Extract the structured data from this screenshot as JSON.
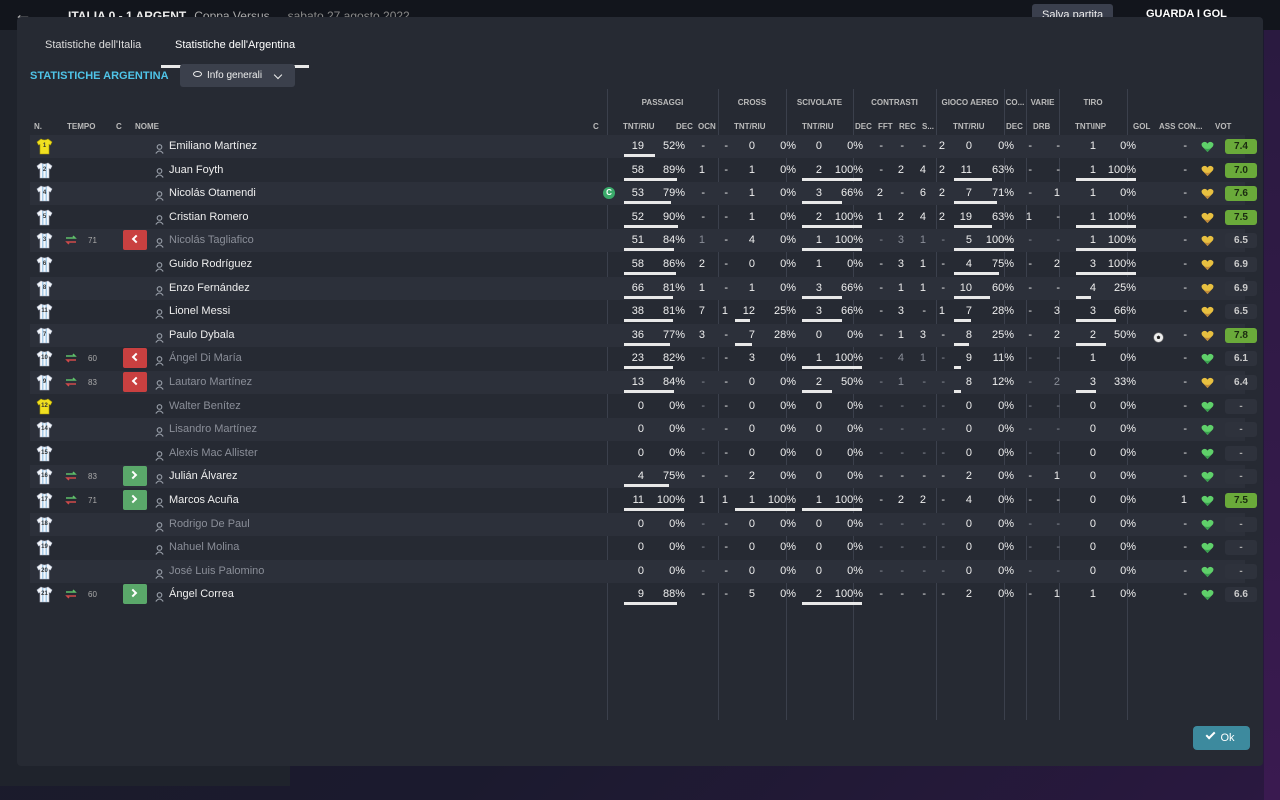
{
  "background": {
    "title": "ITALIA  0 - 1  ARGENT",
    "competition": "Coppa Versus",
    "date": "sabato 27 agosto 2022",
    "save_label": "Salva partita",
    "watch_label": "GUARDA I GOL"
  },
  "tabs": [
    "Statistiche dell'Italia",
    "Statistiche dell'Argentina"
  ],
  "section_title": "STATISTICHE ARGENTINA",
  "dropdown": {
    "label": "Info generali"
  },
  "groups": {
    "passaggi": "PASSAGGI",
    "cross": "CROSS",
    "scivolate": "SCIVOLATE",
    "contrasti": "CONTRASTI",
    "gioco_aereo": "GIOCO AEREO",
    "co": "CO...",
    "varie": "VARIE",
    "tiro": "TIRO"
  },
  "columns": {
    "n": "N.",
    "tempo": "TEMPO",
    "c": "C",
    "nome": "NOME",
    "c2": "C",
    "tntriu": "TNT/RIU",
    "dec": "DEC",
    "ocn": "OCN",
    "cross_tntriu": "TNT/RIU",
    "sciv_tntriu": "TNT/RIU",
    "cdec": "DEC",
    "fft": "FFT",
    "rec": "REC",
    "s": "S...",
    "ga_tntriu": "TNT/RIU",
    "co_dec": "DEC",
    "drb": "DRB",
    "tntinp": "TNT\\INP",
    "gol": "GOL",
    "ass": "ASS",
    "con": "CON...",
    "vot": "VOT"
  },
  "colors": {
    "accent": "#4fc4e8",
    "sub_out": "#c94040",
    "sub_in": "#5aa86a",
    "ok": "#3d8a9e"
  },
  "ok_label": "Ok",
  "players": [
    {
      "n": "1",
      "gk": true,
      "tempo": "",
      "sub": "",
      "name": "Emiliano Martínez",
      "dim": false,
      "cap": false,
      "pass": "19",
      "passp": "52%",
      "dec": "-",
      "ocn": "-",
      "cr": "0",
      "crp": "0%",
      "sv": "0",
      "svp": "0%",
      "cd": "-",
      "fft": "-",
      "rec": "-",
      "s": "2",
      "ga": "0",
      "gap": "0%",
      "codec": "-",
      "drb": "-",
      "tiro": "1",
      "tirop": "0%",
      "gol": "",
      "ass": "-",
      "heart": "green",
      "vot": "7.4",
      "votc": "hi",
      "ball": false,
      "bars": {
        "pass": 52,
        "cr": 0,
        "sv": 0,
        "ga": 0,
        "ti": 0
      }
    },
    {
      "n": "2",
      "gk": false,
      "tempo": "",
      "sub": "",
      "name": "Juan Foyth",
      "dim": false,
      "cap": false,
      "pass": "58",
      "passp": "89%",
      "dec": "1",
      "ocn": "-",
      "cr": "1",
      "crp": "0%",
      "sv": "2",
      "svp": "100%",
      "cd": "-",
      "fft": "2",
      "rec": "4",
      "s": "2",
      "ga": "11",
      "gap": "63%",
      "codec": "-",
      "drb": "-",
      "tiro": "1",
      "tirop": "100%",
      "gol": "",
      "ass": "-",
      "heart": "yellow",
      "vot": "7.0",
      "votc": "hi",
      "ball": false,
      "bars": {
        "pass": 89,
        "cr": 0,
        "sv": 100,
        "ga": 63,
        "ti": 100
      }
    },
    {
      "n": "4",
      "gk": false,
      "tempo": "",
      "sub": "",
      "name": "Nicolás Otamendi",
      "dim": false,
      "cap": true,
      "pass": "53",
      "passp": "79%",
      "dec": "-",
      "ocn": "-",
      "cr": "1",
      "crp": "0%",
      "sv": "3",
      "svp": "66%",
      "cd": "2",
      "fft": "-",
      "rec": "6",
      "s": "2",
      "ga": "7",
      "gap": "71%",
      "codec": "-",
      "drb": "1",
      "tiro": "1",
      "tirop": "0%",
      "gol": "",
      "ass": "-",
      "heart": "yellow",
      "vot": "7.6",
      "votc": "hi",
      "ball": false,
      "bars": {
        "pass": 79,
        "cr": 0,
        "sv": 66,
        "ga": 71,
        "ti": 0
      }
    },
    {
      "n": "5",
      "gk": false,
      "tempo": "",
      "sub": "",
      "name": "Cristian Romero",
      "dim": false,
      "cap": false,
      "pass": "52",
      "passp": "90%",
      "dec": "-",
      "ocn": "-",
      "cr": "1",
      "crp": "0%",
      "sv": "2",
      "svp": "100%",
      "cd": "1",
      "fft": "2",
      "rec": "4",
      "s": "2",
      "ga": "19",
      "gap": "63%",
      "codec": "1",
      "drb": "-",
      "tiro": "1",
      "tirop": "100%",
      "gol": "",
      "ass": "-",
      "heart": "yellow",
      "vot": "7.5",
      "votc": "hi",
      "ball": false,
      "bars": {
        "pass": 90,
        "cr": 0,
        "sv": 100,
        "ga": 63,
        "ti": 100
      }
    },
    {
      "n": "3",
      "gk": false,
      "tempo": "71",
      "sub": "out",
      "name": "Nicolás Tagliafico",
      "dim": true,
      "cap": false,
      "pass": "51",
      "passp": "84%",
      "dec": "1",
      "ocn": "-",
      "cr": "4",
      "crp": "0%",
      "sv": "1",
      "svp": "100%",
      "cd": "-",
      "fft": "3",
      "rec": "1",
      "s": "-",
      "ga": "5",
      "gap": "100%",
      "codec": "-",
      "drb": "-",
      "tiro": "1",
      "tirop": "100%",
      "gol": "",
      "ass": "-",
      "heart": "yellow",
      "vot": "6.5",
      "votc": "plain",
      "ball": false,
      "bars": {
        "pass": 84,
        "cr": 0,
        "sv": 100,
        "ga": 100,
        "ti": 100
      }
    },
    {
      "n": "6",
      "gk": false,
      "tempo": "",
      "sub": "",
      "name": "Guido Rodríguez",
      "dim": false,
      "cap": false,
      "pass": "58",
      "passp": "86%",
      "dec": "2",
      "ocn": "-",
      "cr": "0",
      "crp": "0%",
      "sv": "1",
      "svp": "0%",
      "cd": "-",
      "fft": "3",
      "rec": "1",
      "s": "-",
      "ga": "4",
      "gap": "75%",
      "codec": "-",
      "drb": "2",
      "tiro": "3",
      "tirop": "100%",
      "gol": "",
      "ass": "-",
      "heart": "yellow",
      "vot": "6.9",
      "votc": "plain",
      "ball": false,
      "bars": {
        "pass": 86,
        "cr": 0,
        "sv": 0,
        "ga": 75,
        "ti": 100
      }
    },
    {
      "n": "8",
      "gk": false,
      "tempo": "",
      "sub": "",
      "name": "Enzo Fernández",
      "dim": false,
      "cap": false,
      "pass": "66",
      "passp": "81%",
      "dec": "1",
      "ocn": "-",
      "cr": "1",
      "crp": "0%",
      "sv": "3",
      "svp": "66%",
      "cd": "-",
      "fft": "1",
      "rec": "1",
      "s": "-",
      "ga": "10",
      "gap": "60%",
      "codec": "-",
      "drb": "-",
      "tiro": "4",
      "tirop": "25%",
      "gol": "",
      "ass": "-",
      "heart": "yellow",
      "vot": "6.9",
      "votc": "plain",
      "ball": false,
      "bars": {
        "pass": 81,
        "cr": 0,
        "sv": 66,
        "ga": 60,
        "ti": 25
      }
    },
    {
      "n": "11",
      "gk": false,
      "tempo": "",
      "sub": "",
      "name": "Lionel Messi",
      "dim": false,
      "cap": false,
      "pass": "38",
      "passp": "81%",
      "dec": "7",
      "ocn": "1",
      "cr": "12",
      "crp": "25%",
      "sv": "3",
      "svp": "66%",
      "cd": "-",
      "fft": "3",
      "rec": "-",
      "s": "1",
      "ga": "7",
      "gap": "28%",
      "codec": "-",
      "drb": "3",
      "tiro": "3",
      "tirop": "66%",
      "gol": "",
      "ass": "-",
      "heart": "yellow",
      "vot": "6.5",
      "votc": "plain",
      "ball": false,
      "bars": {
        "pass": 81,
        "cr": 25,
        "sv": 66,
        "ga": 28,
        "ti": 66
      }
    },
    {
      "n": "7",
      "gk": false,
      "tempo": "",
      "sub": "",
      "name": "Paulo Dybala",
      "dim": false,
      "cap": false,
      "pass": "36",
      "passp": "77%",
      "dec": "3",
      "ocn": "-",
      "cr": "7",
      "crp": "28%",
      "sv": "0",
      "svp": "0%",
      "cd": "-",
      "fft": "1",
      "rec": "3",
      "s": "-",
      "ga": "8",
      "gap": "25%",
      "codec": "-",
      "drb": "2",
      "tiro": "2",
      "tirop": "50%",
      "gol": "",
      "ass": "-",
      "heart": "yellow",
      "vot": "7.8",
      "votc": "hi",
      "ball": true,
      "bars": {
        "pass": 77,
        "cr": 28,
        "sv": 0,
        "ga": 25,
        "ti": 50
      }
    },
    {
      "n": "10",
      "gk": false,
      "tempo": "60",
      "sub": "out",
      "name": "Ángel Di María",
      "dim": true,
      "cap": false,
      "pass": "23",
      "passp": "82%",
      "dec": "-",
      "ocn": "-",
      "cr": "3",
      "crp": "0%",
      "sv": "1",
      "svp": "100%",
      "cd": "-",
      "fft": "4",
      "rec": "1",
      "s": "-",
      "ga": "9",
      "gap": "11%",
      "codec": "-",
      "drb": "-",
      "tiro": "1",
      "tirop": "0%",
      "gol": "",
      "ass": "-",
      "heart": "green",
      "vot": "6.1",
      "votc": "plain",
      "ball": false,
      "bars": {
        "pass": 82,
        "cr": 0,
        "sv": 100,
        "ga": 11,
        "ti": 0
      }
    },
    {
      "n": "9",
      "gk": false,
      "tempo": "83",
      "sub": "out",
      "name": "Lautaro Martínez",
      "dim": true,
      "cap": false,
      "pass": "13",
      "passp": "84%",
      "dec": "-",
      "ocn": "-",
      "cr": "0",
      "crp": "0%",
      "sv": "2",
      "svp": "50%",
      "cd": "-",
      "fft": "1",
      "rec": "-",
      "s": "-",
      "ga": "8",
      "gap": "12%",
      "codec": "-",
      "drb": "2",
      "tiro": "3",
      "tirop": "33%",
      "gol": "",
      "ass": "-",
      "heart": "yellow",
      "vot": "6.4",
      "votc": "plain",
      "ball": false,
      "bars": {
        "pass": 84,
        "cr": 0,
        "sv": 50,
        "ga": 12,
        "ti": 33
      }
    },
    {
      "n": "12",
      "gk": true,
      "tempo": "",
      "sub": "",
      "name": "Walter Benítez",
      "dim": true,
      "cap": false,
      "pass": "0",
      "passp": "0%",
      "dec": "-",
      "ocn": "-",
      "cr": "0",
      "crp": "0%",
      "sv": "0",
      "svp": "0%",
      "cd": "-",
      "fft": "-",
      "rec": "-",
      "s": "-",
      "ga": "0",
      "gap": "0%",
      "codec": "-",
      "drb": "-",
      "tiro": "0",
      "tirop": "0%",
      "gol": "",
      "ass": "-",
      "heart": "green",
      "vot": "-",
      "votc": "dash",
      "ball": false,
      "bars": {
        "pass": 0,
        "cr": 0,
        "sv": 0,
        "ga": 0,
        "ti": 0
      }
    },
    {
      "n": "14",
      "gk": false,
      "tempo": "",
      "sub": "",
      "name": "Lisandro Martínez",
      "dim": true,
      "cap": false,
      "pass": "0",
      "passp": "0%",
      "dec": "-",
      "ocn": "-",
      "cr": "0",
      "crp": "0%",
      "sv": "0",
      "svp": "0%",
      "cd": "-",
      "fft": "-",
      "rec": "-",
      "s": "-",
      "ga": "0",
      "gap": "0%",
      "codec": "-",
      "drb": "-",
      "tiro": "0",
      "tirop": "0%",
      "gol": "",
      "ass": "-",
      "heart": "green",
      "vot": "-",
      "votc": "dash",
      "ball": false,
      "bars": {
        "pass": 0,
        "cr": 0,
        "sv": 0,
        "ga": 0,
        "ti": 0
      }
    },
    {
      "n": "15",
      "gk": false,
      "tempo": "",
      "sub": "",
      "name": "Alexis Mac Allister",
      "dim": true,
      "cap": false,
      "pass": "0",
      "passp": "0%",
      "dec": "-",
      "ocn": "-",
      "cr": "0",
      "crp": "0%",
      "sv": "0",
      "svp": "0%",
      "cd": "-",
      "fft": "-",
      "rec": "-",
      "s": "-",
      "ga": "0",
      "gap": "0%",
      "codec": "-",
      "drb": "-",
      "tiro": "0",
      "tirop": "0%",
      "gol": "",
      "ass": "-",
      "heart": "green",
      "vot": "-",
      "votc": "dash",
      "ball": false,
      "bars": {
        "pass": 0,
        "cr": 0,
        "sv": 0,
        "ga": 0,
        "ti": 0
      }
    },
    {
      "n": "16",
      "gk": false,
      "tempo": "83",
      "sub": "in",
      "name": "Julián Álvarez",
      "dim": false,
      "cap": false,
      "pass": "4",
      "passp": "75%",
      "dec": "-",
      "ocn": "-",
      "cr": "2",
      "crp": "0%",
      "sv": "0",
      "svp": "0%",
      "cd": "-",
      "fft": "-",
      "rec": "-",
      "s": "-",
      "ga": "2",
      "gap": "0%",
      "codec": "-",
      "drb": "1",
      "tiro": "0",
      "tirop": "0%",
      "gol": "",
      "ass": "-",
      "heart": "green",
      "vot": "-",
      "votc": "dash",
      "ball": false,
      "bars": {
        "pass": 75,
        "cr": 0,
        "sv": 0,
        "ga": 0,
        "ti": 0
      }
    },
    {
      "n": "17",
      "gk": false,
      "tempo": "71",
      "sub": "in",
      "name": "Marcos Acuña",
      "dim": false,
      "cap": false,
      "pass": "11",
      "passp": "100%",
      "dec": "1",
      "ocn": "1",
      "cr": "1",
      "crp": "100%",
      "sv": "1",
      "svp": "100%",
      "cd": "-",
      "fft": "2",
      "rec": "2",
      "s": "-",
      "ga": "4",
      "gap": "0%",
      "codec": "-",
      "drb": "-",
      "tiro": "0",
      "tirop": "0%",
      "gol": "",
      "ass": "1",
      "heart": "green",
      "vot": "7.5",
      "votc": "hi",
      "ball": false,
      "bars": {
        "pass": 100,
        "cr": 100,
        "sv": 100,
        "ga": 0,
        "ti": 0
      }
    },
    {
      "n": "18",
      "gk": false,
      "tempo": "",
      "sub": "",
      "name": "Rodrigo De Paul",
      "dim": true,
      "cap": false,
      "pass": "0",
      "passp": "0%",
      "dec": "-",
      "ocn": "-",
      "cr": "0",
      "crp": "0%",
      "sv": "0",
      "svp": "0%",
      "cd": "-",
      "fft": "-",
      "rec": "-",
      "s": "-",
      "ga": "0",
      "gap": "0%",
      "codec": "-",
      "drb": "-",
      "tiro": "0",
      "tirop": "0%",
      "gol": "",
      "ass": "-",
      "heart": "green",
      "vot": "-",
      "votc": "dash",
      "ball": false,
      "bars": {
        "pass": 0,
        "cr": 0,
        "sv": 0,
        "ga": 0,
        "ti": 0
      }
    },
    {
      "n": "19",
      "gk": false,
      "tempo": "",
      "sub": "",
      "name": "Nahuel Molina",
      "dim": true,
      "cap": false,
      "pass": "0",
      "passp": "0%",
      "dec": "-",
      "ocn": "-",
      "cr": "0",
      "crp": "0%",
      "sv": "0",
      "svp": "0%",
      "cd": "-",
      "fft": "-",
      "rec": "-",
      "s": "-",
      "ga": "0",
      "gap": "0%",
      "codec": "-",
      "drb": "-",
      "tiro": "0",
      "tirop": "0%",
      "gol": "",
      "ass": "-",
      "heart": "green",
      "vot": "-",
      "votc": "dash",
      "ball": false,
      "bars": {
        "pass": 0,
        "cr": 0,
        "sv": 0,
        "ga": 0,
        "ti": 0
      }
    },
    {
      "n": "20",
      "gk": false,
      "tempo": "",
      "sub": "",
      "name": "José Luis Palomino",
      "dim": true,
      "cap": false,
      "pass": "0",
      "passp": "0%",
      "dec": "-",
      "ocn": "-",
      "cr": "0",
      "crp": "0%",
      "sv": "0",
      "svp": "0%",
      "cd": "-",
      "fft": "-",
      "rec": "-",
      "s": "-",
      "ga": "0",
      "gap": "0%",
      "codec": "-",
      "drb": "-",
      "tiro": "0",
      "tirop": "0%",
      "gol": "",
      "ass": "-",
      "heart": "green",
      "vot": "-",
      "votc": "dash",
      "ball": false,
      "bars": {
        "pass": 0,
        "cr": 0,
        "sv": 0,
        "ga": 0,
        "ti": 0
      }
    },
    {
      "n": "21",
      "gk": false,
      "tempo": "60",
      "sub": "in",
      "name": "Ángel Correa",
      "dim": false,
      "cap": false,
      "pass": "9",
      "passp": "88%",
      "dec": "-",
      "ocn": "-",
      "cr": "5",
      "crp": "0%",
      "sv": "2",
      "svp": "100%",
      "cd": "-",
      "fft": "-",
      "rec": "-",
      "s": "-",
      "ga": "2",
      "gap": "0%",
      "codec": "-",
      "drb": "1",
      "tiro": "1",
      "tirop": "0%",
      "gol": "",
      "ass": "-",
      "heart": "green",
      "vot": "6.6",
      "votc": "plain",
      "ball": false,
      "bars": {
        "pass": 88,
        "cr": 0,
        "sv": 100,
        "ga": 0,
        "ti": 0
      }
    }
  ]
}
